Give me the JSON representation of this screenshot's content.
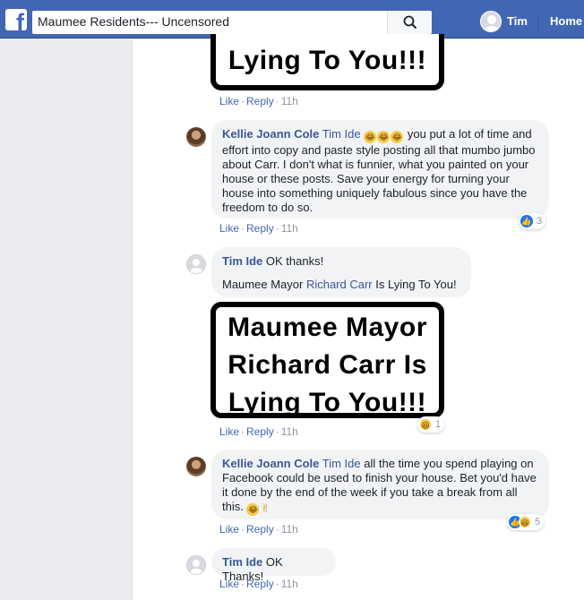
{
  "header": {
    "logo_letter": "f",
    "search_value": "Maumee Residents--- Uncensored",
    "user_name": "Tim",
    "home_label": "Home"
  },
  "meme": {
    "lines": [
      "Maumee Mayor",
      "Richard Carr Is",
      "Lying To You!!!"
    ]
  },
  "top_actions": {
    "like": "Like",
    "reply": "Reply",
    "time": "11h"
  },
  "comments": [
    {
      "author": "Kellie Joann Cole",
      "mention": "Tim Ide",
      "emojis": [
        "haha",
        "haha",
        "haha"
      ],
      "text": "you put a lot of time and effort into copy and paste style posting all that mumbo jumbo about Carr. I don't what is funnier, what you painted on your house or these posts. Save your energy for turning your house into something uniquely fabulous since you have the freedom to do so.",
      "reaction_count": "3",
      "like": "Like",
      "reply": "Reply",
      "time": "11h"
    },
    {
      "author": "Tim Ide",
      "text": "OK thanks!",
      "text2_prefix": "Maumee Mayor",
      "text2_mention": "Richard Carr",
      "text2_suffix": "Is Lying To You!",
      "reaction_count": "1",
      "like": "Like",
      "reply": "Reply",
      "time": "11h"
    },
    {
      "author": "Kellie Joann Cole",
      "mention": "Tim Ide",
      "text": "all the time you spend playing on Facebook could be used to finish your house. Bet you'd have it done by the end of the week if you take a break from all this.",
      "reaction_count": "5",
      "like": "Like",
      "reply": "Reply",
      "time": "11h"
    },
    {
      "author": "Tim Ide",
      "text": "OK Thanks!",
      "like": "Like",
      "reply": "Reply",
      "time": "11h"
    }
  ],
  "colors": {
    "brand": "#4267b2",
    "link": "#385898",
    "bubble": "#f2f3f5",
    "page_bg": "#e9ebee"
  }
}
